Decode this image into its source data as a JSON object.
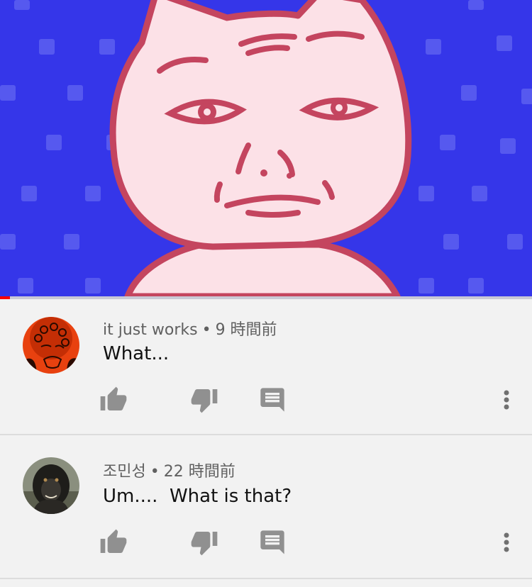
{
  "video": {
    "progress_fraction": 0.018,
    "colors": {
      "background": "#3536e9",
      "face": "#fce1e7",
      "outline": "#c4455f",
      "progress": "#ff0000"
    }
  },
  "comments": [
    {
      "author": "it just works",
      "separator": "•",
      "time": "9 時間前",
      "text": "What...",
      "avatar_icon": "cartoon-face-avatar"
    },
    {
      "author": "조민성",
      "separator": "•",
      "time": "22 時間前",
      "text": "Um....  What is that?",
      "avatar_icon": "gorilla-avatar"
    }
  ],
  "actions": [
    "thumbs-up-icon",
    "thumbs-down-icon",
    "reply-icon",
    "more-vert-icon"
  ]
}
